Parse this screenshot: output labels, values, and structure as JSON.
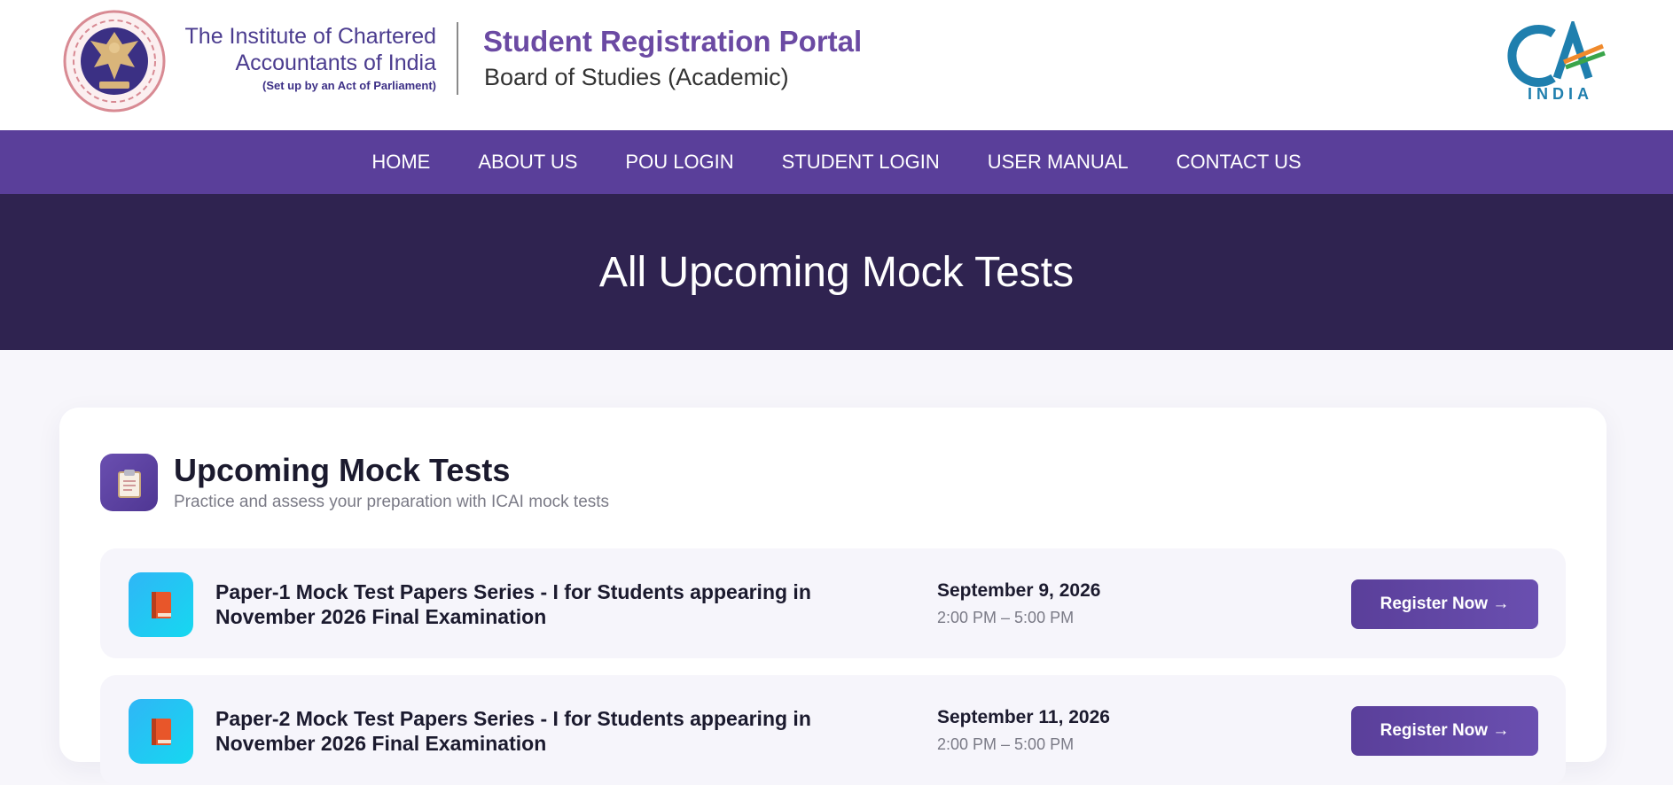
{
  "header": {
    "institute_line1": "The Institute of Chartered",
    "institute_line2": "Accountants of India",
    "institute_line3": "(Set up by an Act of Parliament)",
    "portal_title": "Student Registration Portal",
    "portal_subtitle": "Board of Studies (Academic)",
    "ca_logo_text": "INDIA"
  },
  "nav": {
    "items": [
      {
        "label": "HOME"
      },
      {
        "label": "ABOUT US"
      },
      {
        "label": "POU LOGIN"
      },
      {
        "label": "STUDENT LOGIN"
      },
      {
        "label": "USER MANUAL"
      },
      {
        "label": "CONTACT US"
      }
    ]
  },
  "hero": {
    "title": "All Upcoming Mock Tests"
  },
  "section": {
    "title": "Upcoming Mock Tests",
    "subtitle": "Practice and assess your preparation with ICAI mock tests",
    "icon": "clipboard-icon"
  },
  "tests": [
    {
      "title": "Paper-1 Mock Test Papers Series - I for Students appearing in November 2026 Final Examination",
      "date": "September 9, 2026",
      "time": "2:00 PM – 5:00 PM",
      "button": "Register Now →",
      "icon": "book-icon"
    },
    {
      "title": "Paper-2 Mock Test Papers Series - I for Students appearing in November 2026 Final Examination",
      "date": "September 11, 2026",
      "time": "2:00 PM – 5:00 PM",
      "button": "Register Now →",
      "icon": "book-icon"
    }
  ],
  "colors": {
    "brand_purple": "#5a3f9a",
    "hero_dark": "#2f2350",
    "title_purple": "#6b4aa3",
    "icon_cyan": "#16d8f0"
  }
}
